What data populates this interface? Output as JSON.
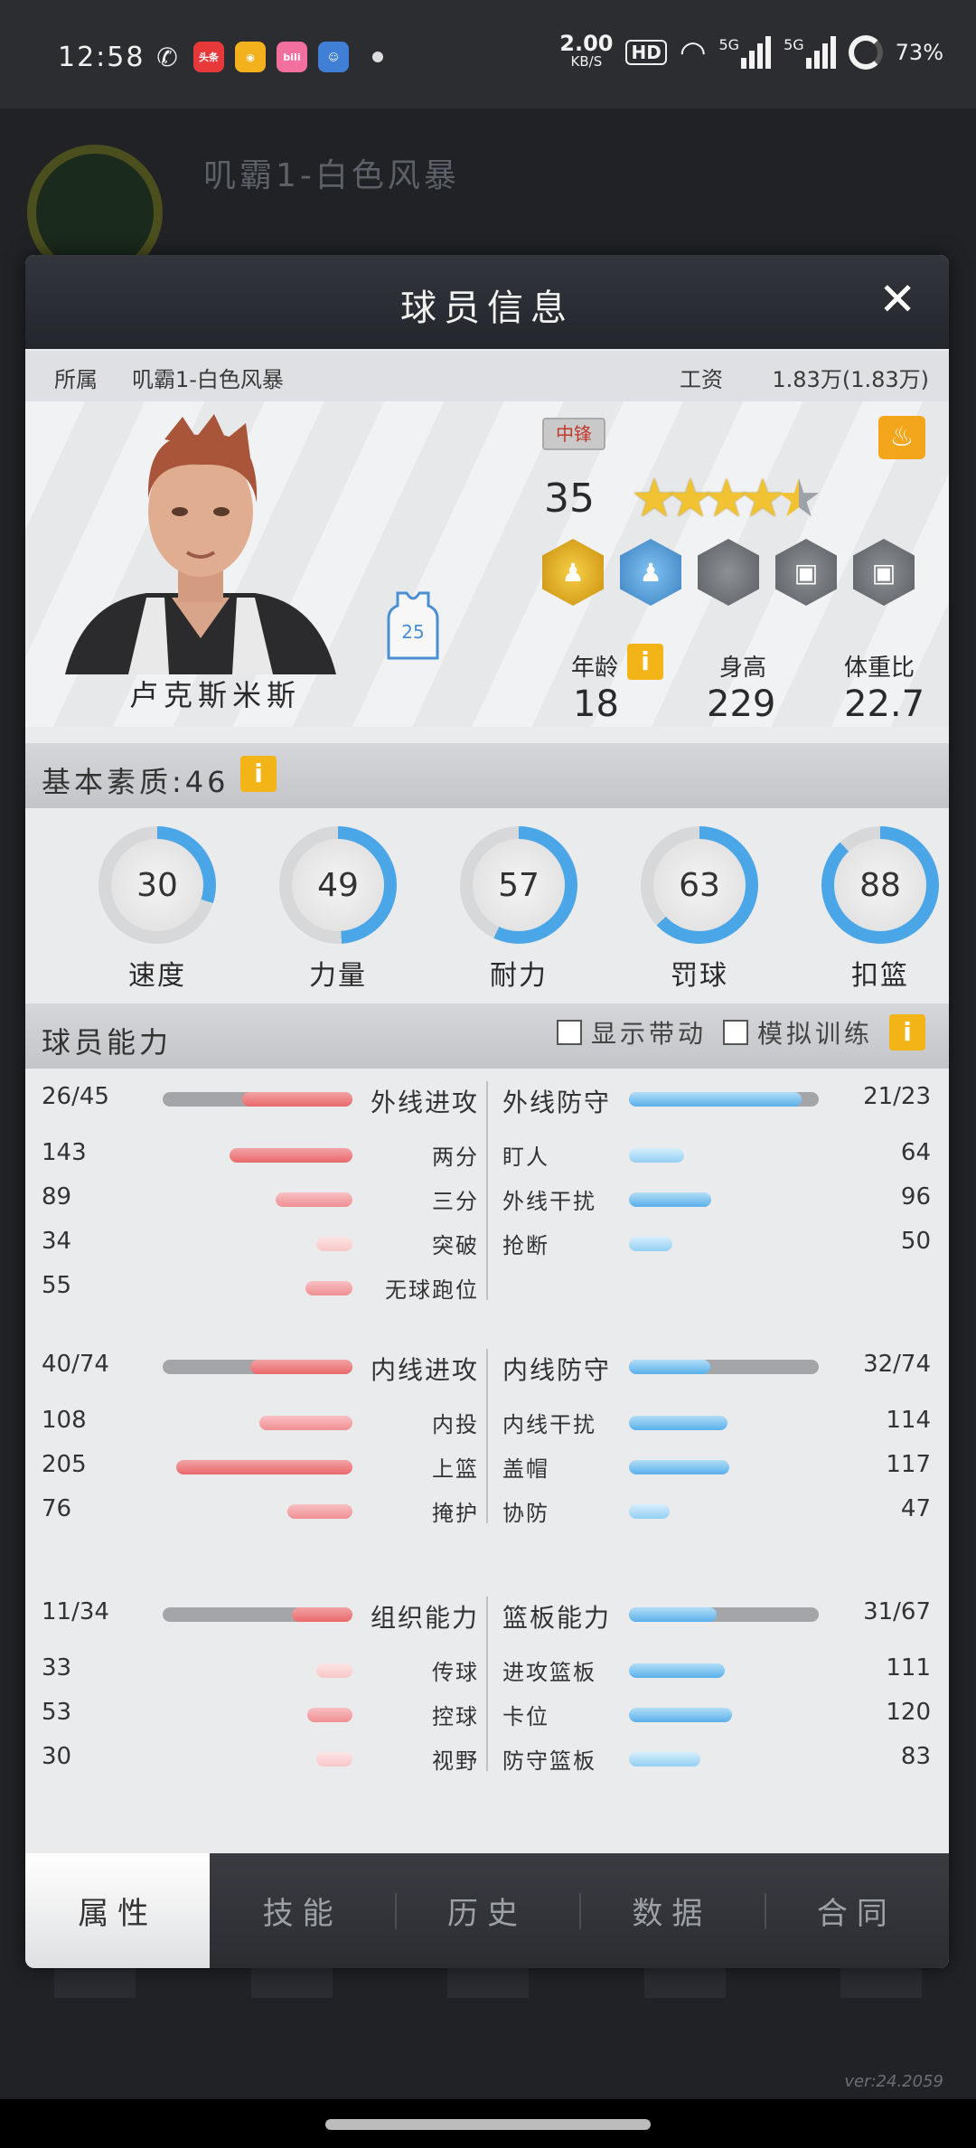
{
  "status_bar": {
    "time": "12:58",
    "apps": [
      {
        "icon": "wechat-icon",
        "label": "",
        "color": "#2c2d30"
      },
      {
        "icon": "toutiao-icon",
        "label": "头条",
        "color": "#e8393a"
      },
      {
        "icon": "weibo-icon",
        "label": "",
        "color": "#f3b21d"
      },
      {
        "icon": "bilibili-icon",
        "label": "bili",
        "color": "#f36f9d"
      },
      {
        "icon": "game-app-icon",
        "label": "",
        "color": "#3f7fd6"
      }
    ],
    "speed_value": "2.00",
    "speed_unit": "KB/S",
    "hd_badge": "HD",
    "network_5g": "5G",
    "network_5g_2": "5G",
    "battery": "73%"
  },
  "background": {
    "team_name": "叽霸1-白色风暴",
    "version": "ver:24.2059"
  },
  "modal": {
    "title": "球员信息",
    "close": "✕",
    "team_label": "所属",
    "team_name": "叽霸1-白色风暴",
    "salary_label": "工资",
    "salary_value": "1.83万(1.83万)",
    "player_name": "卢克斯米斯",
    "jersey_number": "25",
    "position": "中锋",
    "fire_icon": "flame-icon",
    "rating": "35",
    "stars": {
      "full": 4,
      "half": 1
    },
    "medals": [
      {
        "icon": "gold-player-medal-icon",
        "type": "gold"
      },
      {
        "icon": "blue-player-medal-icon",
        "type": "blue"
      },
      {
        "icon": "grey-medal-icon",
        "type": "grey"
      },
      {
        "icon": "locked-medal-icon",
        "type": "grey"
      },
      {
        "icon": "locked-medal-icon",
        "type": "grey"
      }
    ],
    "attributes": {
      "age_label": "年龄",
      "height_label": "身高",
      "weight_label": "体重比",
      "age": "18",
      "height": "229",
      "weight": "22.7"
    },
    "basic": {
      "title": "基本素质:46",
      "stats": [
        {
          "label": "速度",
          "value": "30",
          "percent": 30
        },
        {
          "label": "力量",
          "value": "49",
          "percent": 49
        },
        {
          "label": "耐力",
          "value": "57",
          "percent": 57
        },
        {
          "label": "罚球",
          "value": "63",
          "percent": 63
        },
        {
          "label": "扣篮",
          "value": "88",
          "percent": 88
        }
      ]
    },
    "ability": {
      "title": "球员能力",
      "show_dynamic": "显示带动",
      "simulate_training": "模拟训练",
      "groups": [
        {
          "left": {
            "label": "外线进攻",
            "value": "26/45",
            "ratio": 0.58
          },
          "right": {
            "label": "外线防守",
            "value": "21/23",
            "ratio": 0.91
          },
          "left_items": [
            {
              "label": "两分",
              "value": "143"
            },
            {
              "label": "三分",
              "value": "89"
            },
            {
              "label": "突破",
              "value": "34"
            },
            {
              "label": "无球跑位",
              "value": "55"
            }
          ],
          "right_items": [
            {
              "label": "盯人",
              "value": "64"
            },
            {
              "label": "外线干扰",
              "value": "96"
            },
            {
              "label": "抢断",
              "value": "50"
            }
          ]
        },
        {
          "left": {
            "label": "内线进攻",
            "value": "40/74",
            "ratio": 0.54
          },
          "right": {
            "label": "内线防守",
            "value": "32/74",
            "ratio": 0.43
          },
          "left_items": [
            {
              "label": "内投",
              "value": "108"
            },
            {
              "label": "上篮",
              "value": "205"
            },
            {
              "label": "掩护",
              "value": "76"
            }
          ],
          "right_items": [
            {
              "label": "内线干扰",
              "value": "114"
            },
            {
              "label": "盖帽",
              "value": "117"
            },
            {
              "label": "协防",
              "value": "47"
            }
          ]
        },
        {
          "left": {
            "label": "组织能力",
            "value": "11/34",
            "ratio": 0.32
          },
          "right": {
            "label": "篮板能力",
            "value": "31/67",
            "ratio": 0.46
          },
          "left_items": [
            {
              "label": "传球",
              "value": "33"
            },
            {
              "label": "控球",
              "value": "53"
            },
            {
              "label": "视野",
              "value": "30"
            }
          ],
          "right_items": [
            {
              "label": "进攻篮板",
              "value": "111"
            },
            {
              "label": "卡位",
              "value": "120"
            },
            {
              "label": "防守篮板",
              "value": "83"
            }
          ]
        }
      ]
    },
    "tabs": [
      {
        "label": "属性",
        "active": true
      },
      {
        "label": "技能",
        "active": false
      },
      {
        "label": "历史",
        "active": false
      },
      {
        "label": "数据",
        "active": false
      },
      {
        "label": "合同",
        "active": false
      }
    ]
  }
}
